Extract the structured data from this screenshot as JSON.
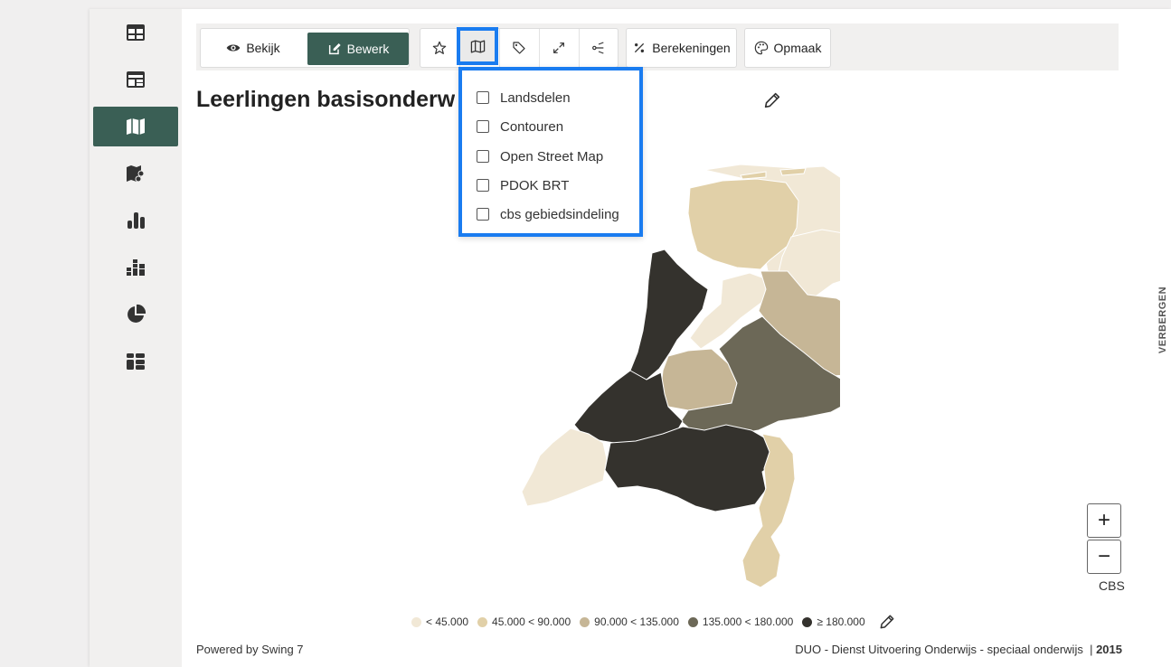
{
  "sidebar": {
    "items": [
      {
        "icon": "table-icon",
        "active": false
      },
      {
        "icon": "dashboard-icon",
        "active": false
      },
      {
        "icon": "map-icon",
        "active": true
      },
      {
        "icon": "map-chart-icon",
        "active": false
      },
      {
        "icon": "bar-chart-icon",
        "active": false
      },
      {
        "icon": "stacked-chart-icon",
        "active": false
      },
      {
        "icon": "pie-chart-icon",
        "active": false
      },
      {
        "icon": "tiles-icon",
        "active": false
      }
    ]
  },
  "toolbar": {
    "view_label": "Bekijk",
    "edit_label": "Bewerk",
    "calc_label": "Berekeningen",
    "format_label": "Opmaak"
  },
  "title": "Leerlingen basisonderwijs per provincies",
  "layers_menu": {
    "items": [
      "Landsdelen",
      "Contouren",
      "Open Street Map",
      "PDOK BRT",
      "cbs gebiedsindeling"
    ]
  },
  "map": {
    "colors": {
      "c1": "#f1e8d6",
      "c2": "#e1d0a8",
      "c3": "#c6b696",
      "c4": "#6c6857",
      "c5": "#34322d"
    }
  },
  "legend": {
    "items": [
      {
        "label": "< 45.000",
        "color": "#f1e8d6"
      },
      {
        "label": "45.000 < 90.000",
        "color": "#e1d0a8"
      },
      {
        "label": "90.000 < 135.000",
        "color": "#c6b696"
      },
      {
        "label": "135.000 < 180.000",
        "color": "#6c6857"
      },
      {
        "label": "≥ 180.000",
        "color": "#34322d"
      }
    ]
  },
  "zoom": {
    "in": "+",
    "out": "−"
  },
  "attribution": "CBS",
  "footer": {
    "powered": "Powered by Swing 7",
    "source": "DUO - Dienst Uitvoering Onderwijs - speciaal onderwijs",
    "year": "2015"
  },
  "hide_label": "VERBERGEN"
}
